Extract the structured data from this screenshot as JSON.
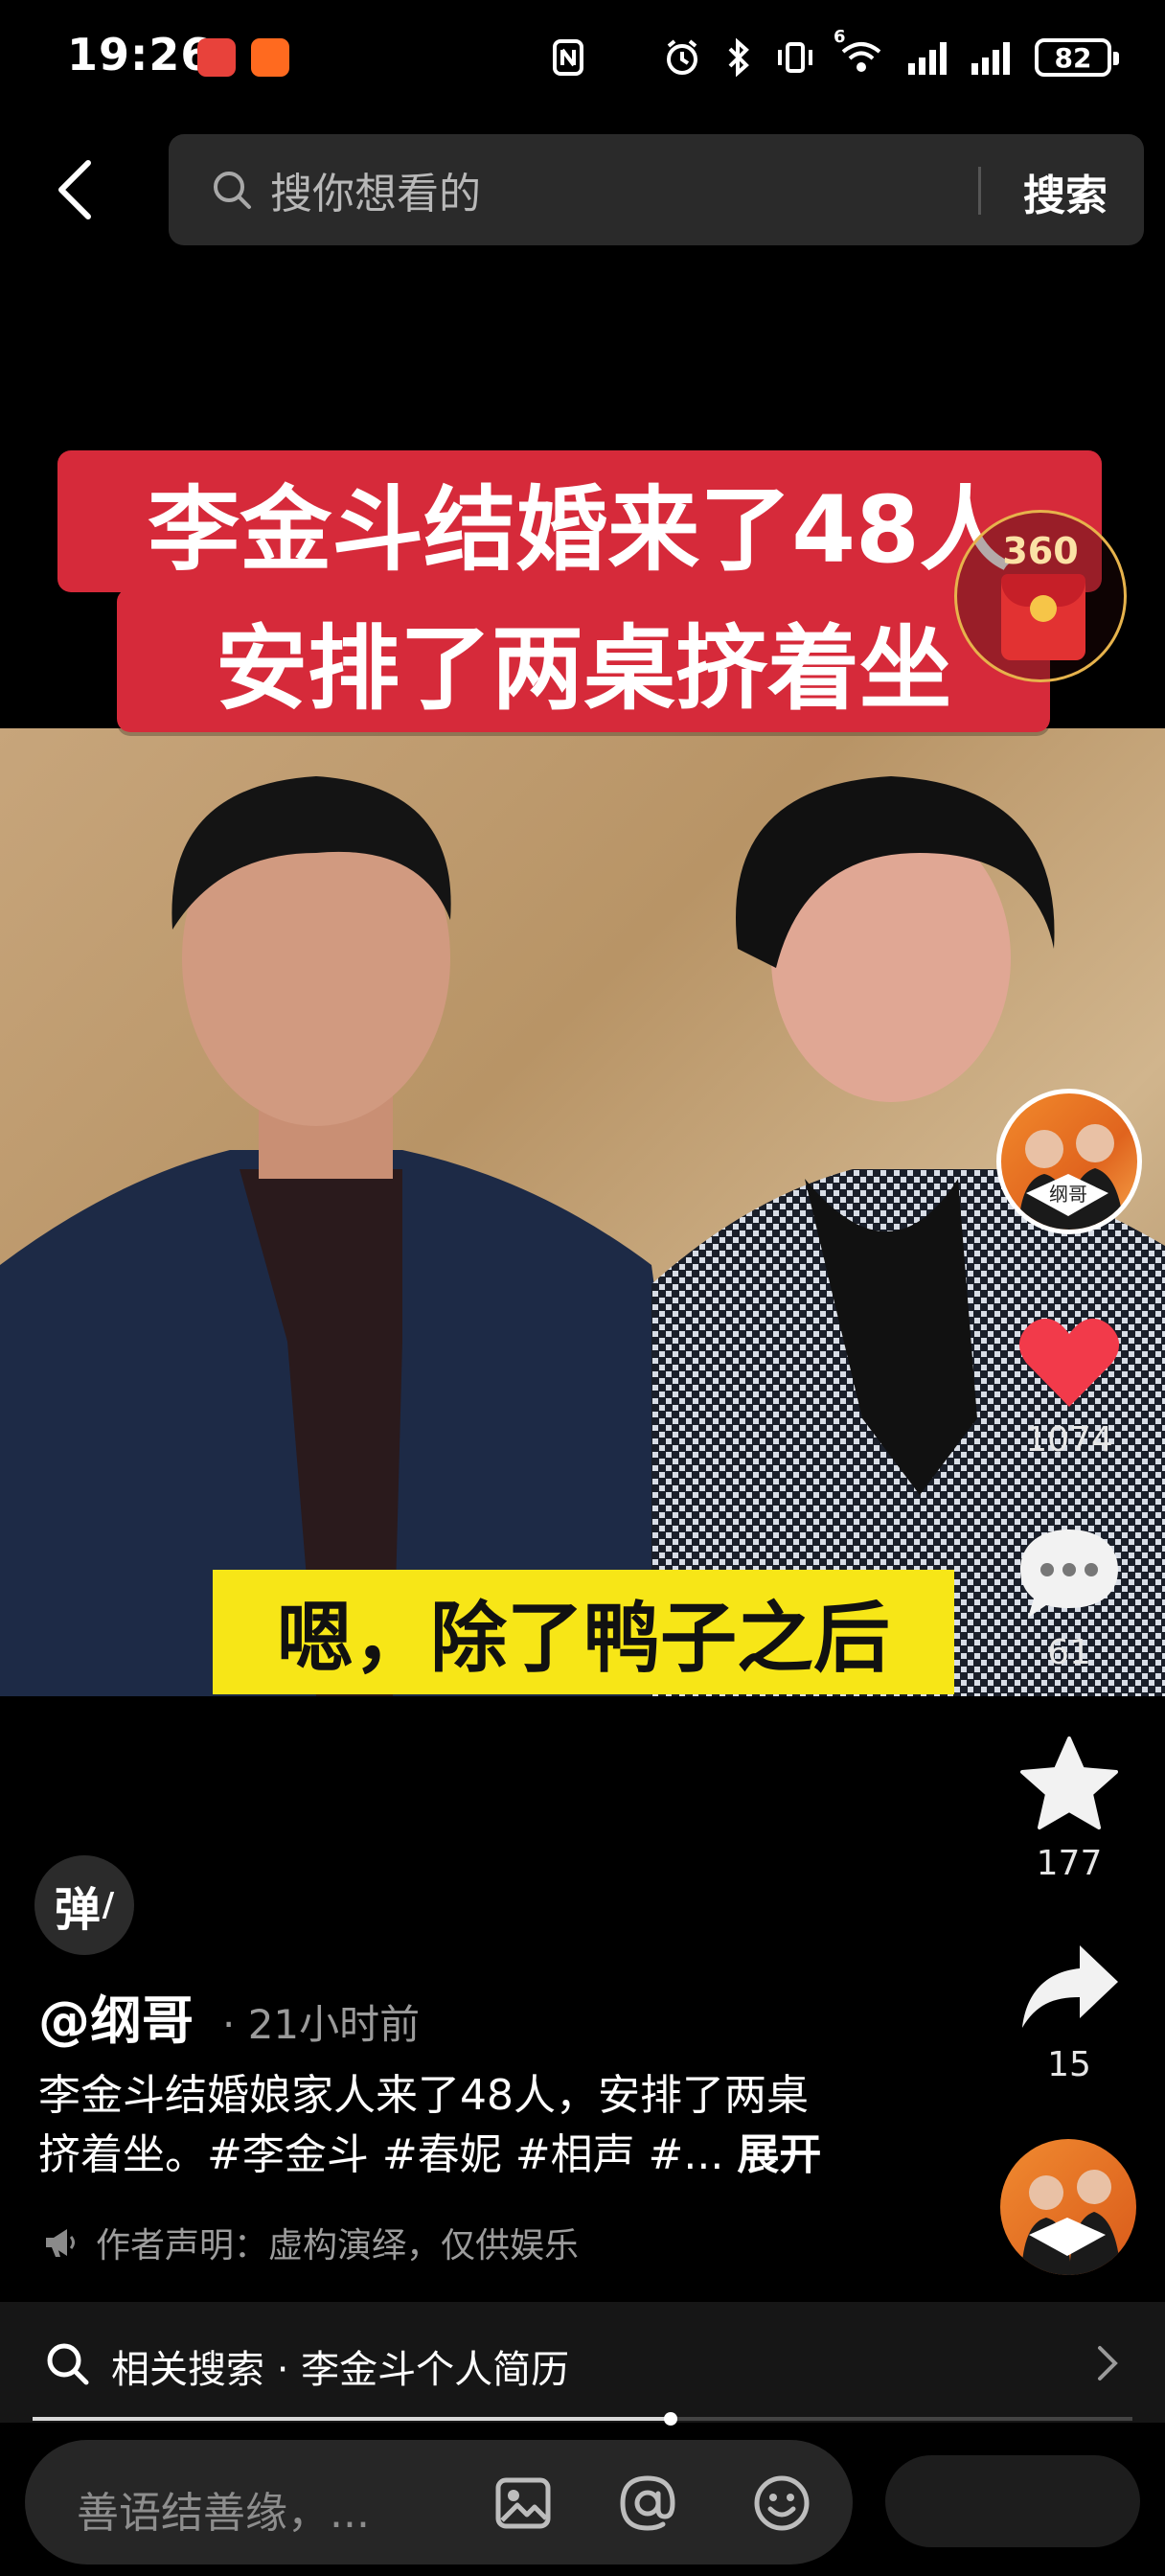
{
  "status_bar": {
    "time": "19:26",
    "battery": "82",
    "network_badge": "6",
    "icons": [
      "huawei-app-icon",
      "orange-app-icon",
      "nfc-icon",
      "alarm-icon",
      "bluetooth-icon",
      "vibrate-icon",
      "wifi-icon",
      "signal-icon",
      "signal-icon",
      "battery-icon"
    ]
  },
  "header": {
    "search_placeholder": "搜你想看的",
    "search_button": "搜索"
  },
  "video": {
    "title_line_1": "李金斗结婚来了48人",
    "title_line_2": "安排了两桌挤着坐",
    "subtitle": "嗯，除了鸭子之后",
    "red_packet_label": "360"
  },
  "rail": {
    "like_count": "1074",
    "comment_count": "61",
    "collect_count": "177",
    "share_count": "15",
    "avatar_caption": "纲哥"
  },
  "danmaku": {
    "label": "弹"
  },
  "info": {
    "author": "@纲哥",
    "time": "· 21小时前",
    "caption_line_1": "李金斗结婚娘家人来了48人，安排了两桌",
    "caption_line_2": "挤着坐。#李金斗 #春妮 #相声 #...",
    "expand": "展开",
    "disclaimer": "作者声明：虚构演绎，仅供娱乐"
  },
  "related": {
    "text": "相关搜索 · 李金斗个人简历"
  },
  "playback": {
    "progress": 0.58
  },
  "comment_bar": {
    "placeholder": "善语结善缘，..."
  },
  "colors": {
    "title_banner": "#d62a3a",
    "subtitle_bg": "#f7e617",
    "like": "#f23a4a",
    "background": "#000000"
  }
}
